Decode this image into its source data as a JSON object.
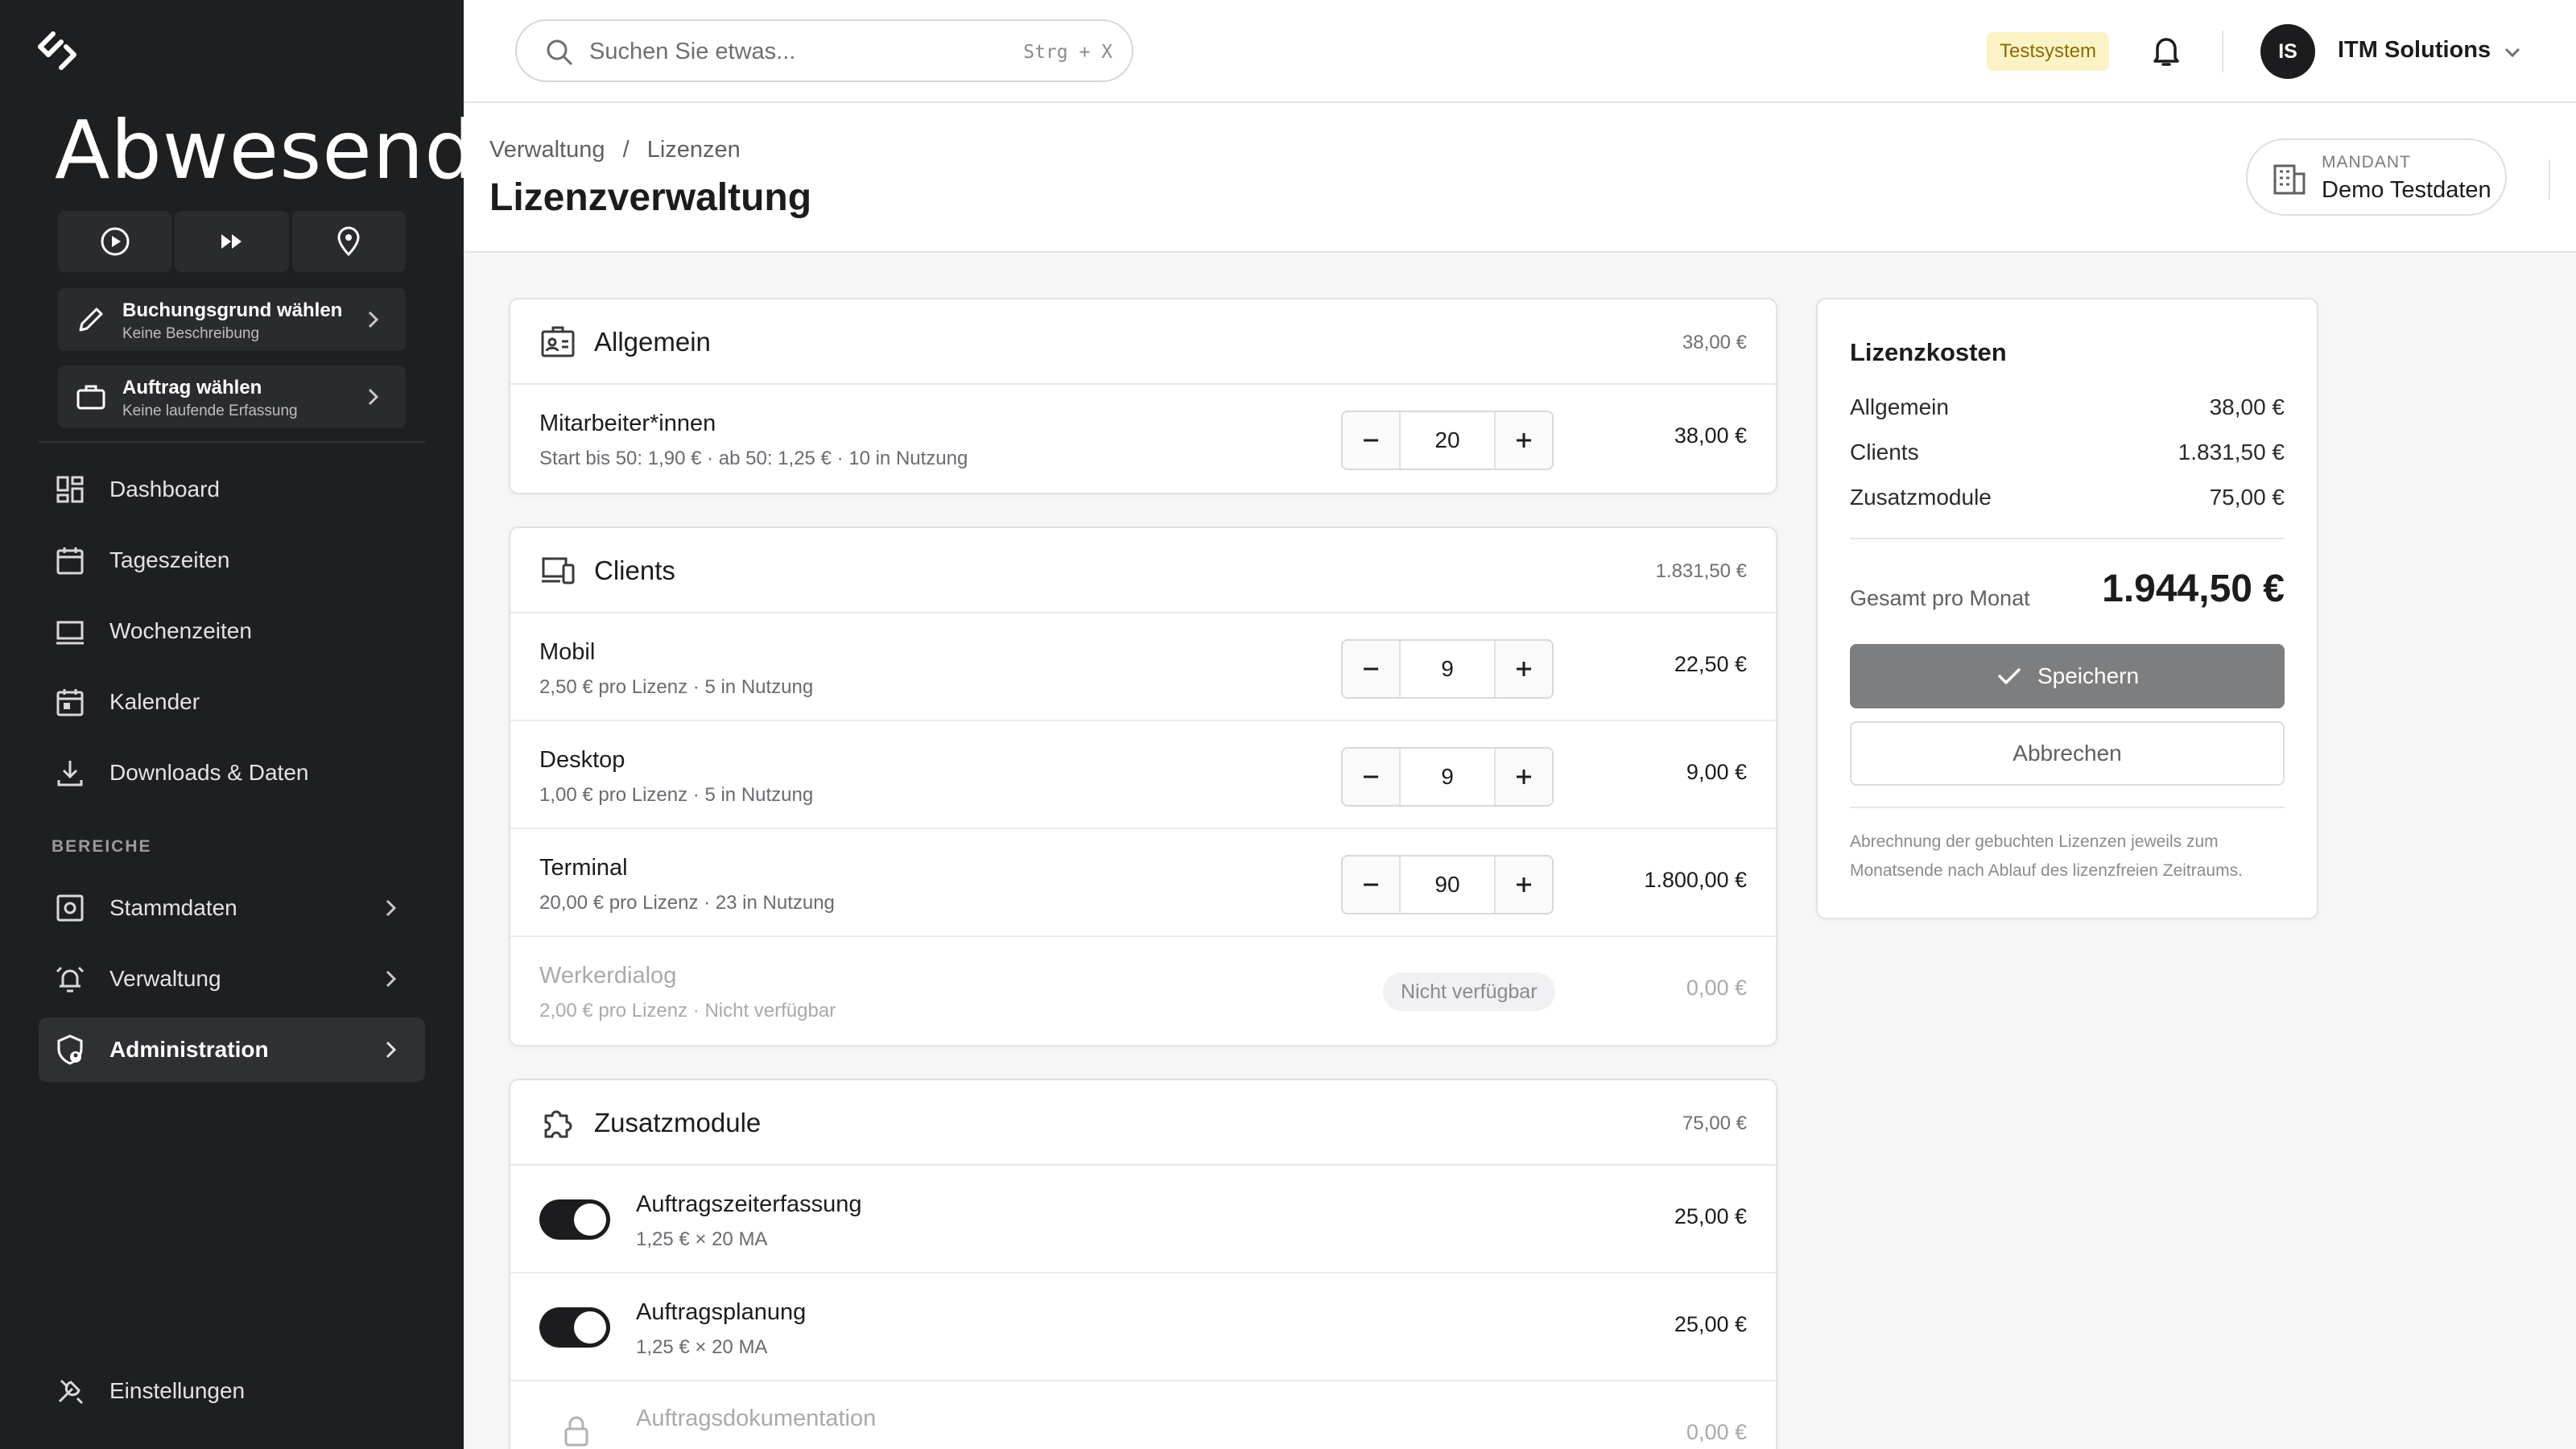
{
  "sidebar": {
    "status": "Abwesend",
    "quick_actions": [
      "play-circle-icon",
      "fast-forward-icon",
      "location-pin-icon"
    ],
    "selectors": [
      {
        "title": "Buchungsgrund wählen",
        "subtitle": "Keine Beschreibung",
        "icon": "pencil-icon"
      },
      {
        "title": "Auftrag wählen",
        "subtitle": "Keine laufende Erfassung",
        "icon": "briefcase-icon"
      }
    ],
    "nav": [
      {
        "label": "Dashboard",
        "icon": "dashboard-icon"
      },
      {
        "label": "Tageszeiten",
        "icon": "calendar-day-icon"
      },
      {
        "label": "Wochenzeiten",
        "icon": "week-view-icon"
      },
      {
        "label": "Kalender",
        "icon": "calendar-icon"
      },
      {
        "label": "Downloads & Daten",
        "icon": "download-icon"
      }
    ],
    "section_label": "BEREICHE",
    "section_nav": [
      {
        "label": "Stammdaten",
        "icon": "master-data-icon"
      },
      {
        "label": "Verwaltung",
        "icon": "alarm-icon"
      },
      {
        "label": "Administration",
        "icon": "admin-shield-icon",
        "active": true
      }
    ],
    "settings_label": "Einstellungen"
  },
  "topbar": {
    "search_placeholder": "Suchen Sie etwas...",
    "search_shortcut": "Strg + X",
    "env_badge": "Testsystem",
    "avatar_initials": "IS",
    "user_name": "ITM Solutions"
  },
  "page": {
    "breadcrumb": [
      "Verwaltung",
      "/",
      "Lizenzen"
    ],
    "title": "Lizenzverwaltung",
    "tenant_label": "MANDANT",
    "tenant_value": "Demo Testdaten"
  },
  "sections": {
    "allgemein": {
      "title": "Allgemein",
      "sum": "38,00 €",
      "rows": [
        {
          "name": "Mitarbeiter*innen",
          "desc": "Start bis 50: 1,90 € · ab 50: 1,25 € · 10 in Nutzung",
          "qty": "20",
          "price": "38,00 €"
        }
      ]
    },
    "clients": {
      "title": "Clients",
      "sum": "1.831,50 €",
      "rows": [
        {
          "name": "Mobil",
          "desc": "2,50 € pro Lizenz · 5 in Nutzung",
          "qty": "9",
          "price": "22,50 €"
        },
        {
          "name": "Desktop",
          "desc": "1,00 € pro Lizenz · 5 in Nutzung",
          "qty": "9",
          "price": "9,00 €"
        },
        {
          "name": "Terminal",
          "desc": "20,00 € pro Lizenz · 23 in Nutzung",
          "qty": "90",
          "price": "1.800,00 €"
        },
        {
          "name": "Werkerdialog",
          "desc": "2,00 € pro Lizenz · Nicht verfügbar",
          "status": "Nicht verfügbar",
          "price": "0,00 €"
        }
      ]
    },
    "zusatz": {
      "title": "Zusatzmodule",
      "sum": "75,00 €",
      "rows": [
        {
          "name": "Auftragszeiterfassung",
          "desc": "1,25 € × 20 MA",
          "price": "25,00 €",
          "enabled": true
        },
        {
          "name": "Auftragsplanung",
          "desc": "1,25 € × 20 MA",
          "price": "25,00 €",
          "enabled": true
        },
        {
          "name": "Auftragsdokumentation",
          "desc": "",
          "price": "0,00 €",
          "locked": true
        }
      ]
    }
  },
  "summary": {
    "title": "Lizenzkosten",
    "lines": [
      {
        "label": "Allgemein",
        "value": "38,00 €"
      },
      {
        "label": "Clients",
        "value": "1.831,50 €"
      },
      {
        "label": "Zusatzmodule",
        "value": "75,00 €"
      }
    ],
    "total_label": "Gesamt pro Monat",
    "total_value": "1.944,50 €",
    "save_label": "Speichern",
    "cancel_label": "Abbrechen",
    "note": "Abrechnung der gebuchten Lizenzen jeweils zum Monatsende nach Ablauf des lizenzfreien Zeitraums."
  },
  "colors": {
    "sidebar_bg": "#1e1f21",
    "accent_dark": "#1c1c1e",
    "badge_bg": "#fbf3c5",
    "save_button": "#7d7e80"
  }
}
